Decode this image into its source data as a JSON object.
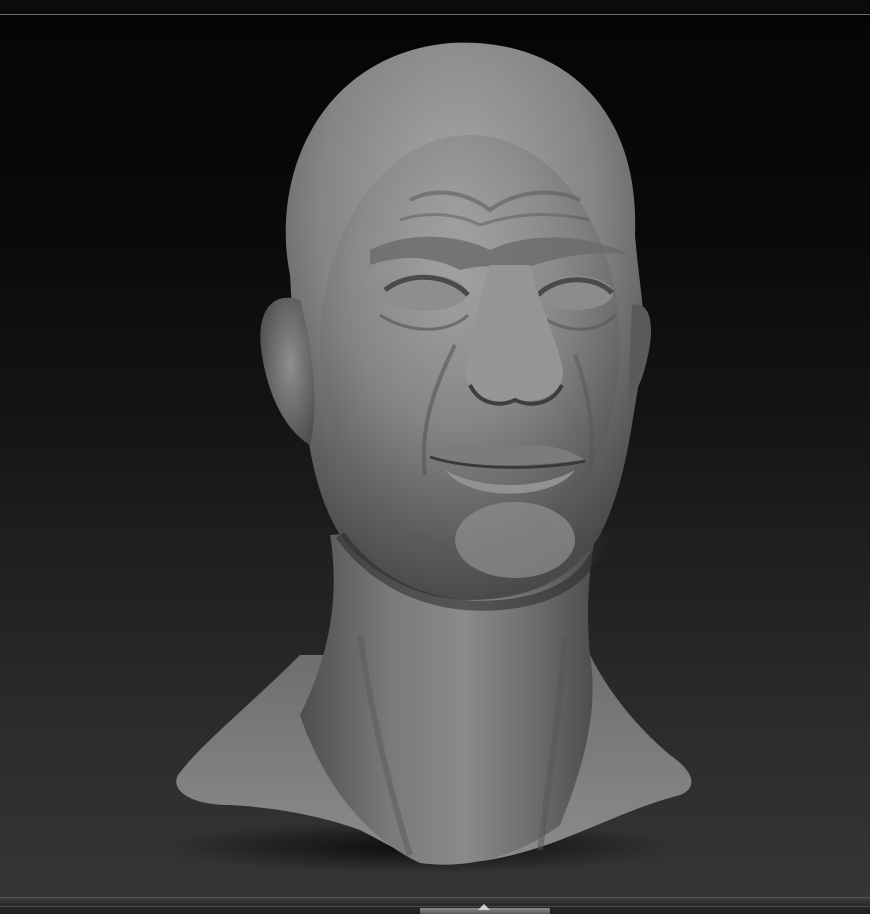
{
  "app": {
    "accent_color": "#6a6a6a",
    "background_color": "#111111"
  },
  "viewport": {
    "model_icon": "sculpted-head-icon",
    "model_color": "#8a8a8a"
  },
  "bottom_bar": {
    "handle_icon": "chevron-up-icon"
  }
}
